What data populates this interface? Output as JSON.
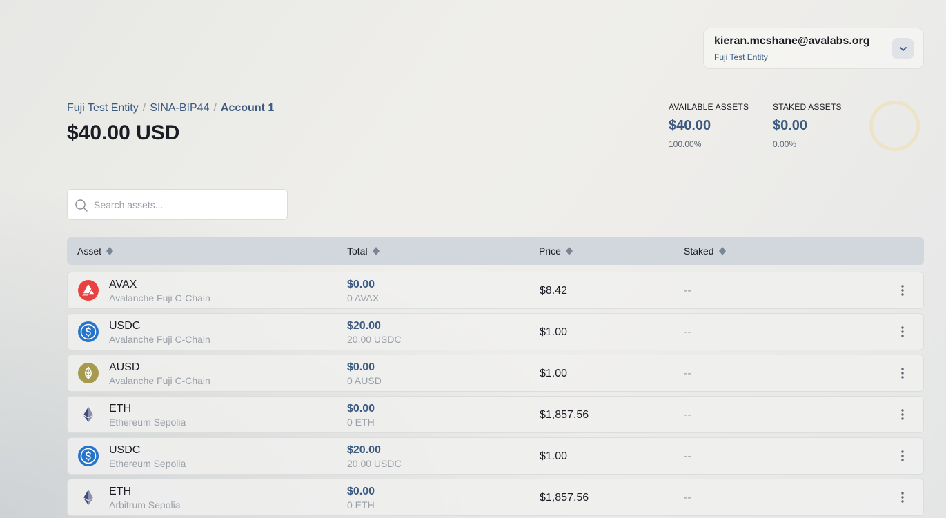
{
  "user": {
    "email": "kieran.mcshane@avalabs.org",
    "entity": "Fuji Test Entity"
  },
  "breadcrumb": {
    "items": [
      "Fuji Test Entity",
      "SINA-BIP44",
      "Account 1"
    ],
    "separator": "/"
  },
  "balance": "$40.00 USD",
  "stats": {
    "available": {
      "label": "AVAILABLE ASSETS",
      "value": "$40.00",
      "pct": "100.00%"
    },
    "staked": {
      "label": "STAKED ASSETS",
      "value": "$0.00",
      "pct": "0.00%"
    },
    "donut_available_fraction": 1.0,
    "donut_color": "#ede4c8"
  },
  "search": {
    "placeholder": "Search assets..."
  },
  "table": {
    "columns": [
      "Asset",
      "Total",
      "Price",
      "Staked"
    ],
    "rows": [
      {
        "icon": "avax-icon",
        "name": "AVAX",
        "chain": "Avalanche Fuji C-Chain",
        "total_usd": "$0.00",
        "total_amount": "0 AVAX",
        "price": "$8.42",
        "staked": "--"
      },
      {
        "icon": "usdc-icon",
        "name": "USDC",
        "chain": "Avalanche Fuji C-Chain",
        "total_usd": "$20.00",
        "total_amount": "20.00 USDC",
        "price": "$1.00",
        "staked": "--"
      },
      {
        "icon": "ausd-icon",
        "name": "AUSD",
        "chain": "Avalanche Fuji C-Chain",
        "total_usd": "$0.00",
        "total_amount": "0 AUSD",
        "price": "$1.00",
        "staked": "--"
      },
      {
        "icon": "eth-icon",
        "name": "ETH",
        "chain": "Ethereum Sepolia",
        "total_usd": "$0.00",
        "total_amount": "0 ETH",
        "price": "$1,857.56",
        "staked": "--"
      },
      {
        "icon": "usdc-icon",
        "name": "USDC",
        "chain": "Ethereum Sepolia",
        "total_usd": "$20.00",
        "total_amount": "20.00 USDC",
        "price": "$1.00",
        "staked": "--"
      },
      {
        "icon": "eth-icon",
        "name": "ETH",
        "chain": "Arbitrum Sepolia",
        "total_usd": "$0.00",
        "total_amount": "0 ETH",
        "price": "$1,857.56",
        "staked": "--"
      }
    ]
  },
  "colors": {
    "accent": "#3c5a80",
    "avax": "#e84142",
    "usdc": "#2775ca",
    "ausd": "#a59a4e",
    "eth": "#454a75"
  }
}
